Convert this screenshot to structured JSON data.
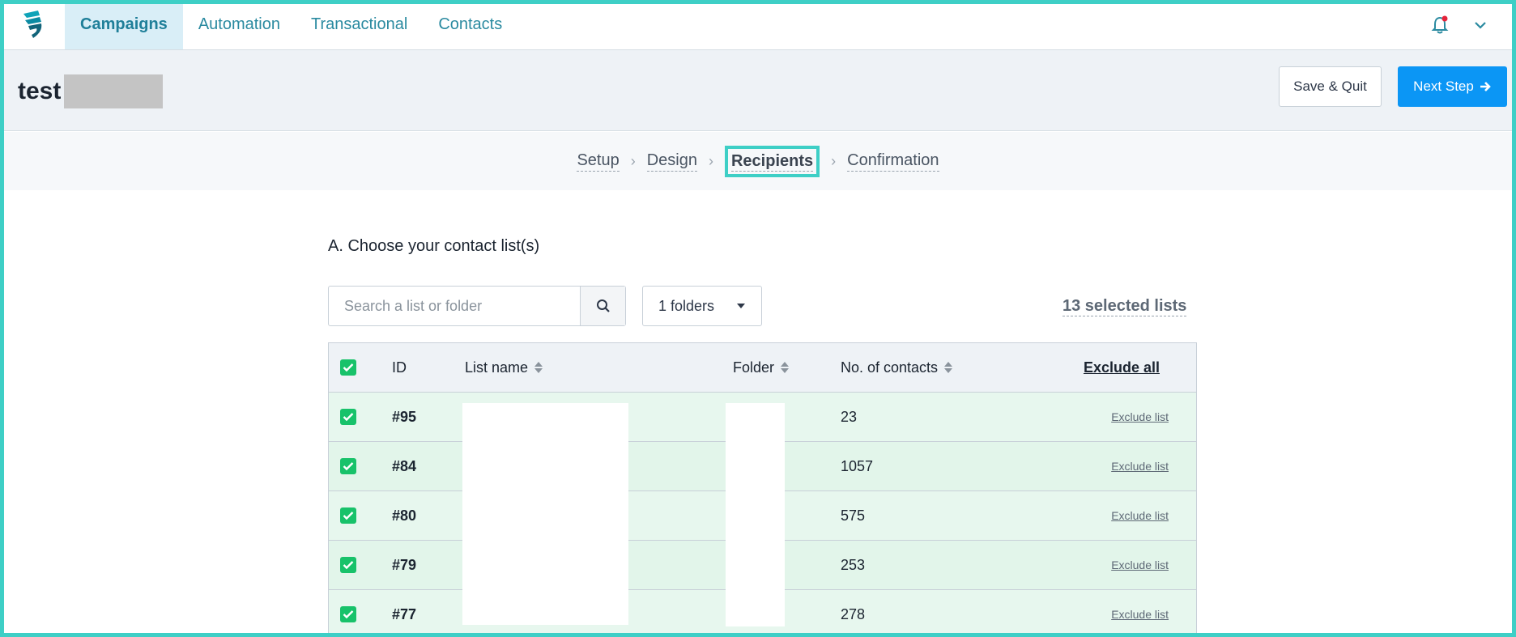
{
  "nav": {
    "tabs": [
      {
        "label": "Campaigns",
        "active": true
      },
      {
        "label": "Automation",
        "active": false
      },
      {
        "label": "Transactional",
        "active": false
      },
      {
        "label": "Contacts",
        "active": false
      }
    ],
    "notification_dot_color": "#e5243b",
    "accent_color": "#2a8aa0"
  },
  "header": {
    "title": "test",
    "save_quit_label": "Save & Quit",
    "next_step_label": "Next Step"
  },
  "steps": {
    "items": [
      "Setup",
      "Design",
      "Recipients",
      "Confirmation"
    ],
    "current": "Recipients"
  },
  "section": {
    "title": "A. Choose your contact list(s)",
    "search_placeholder": "Search a list or folder",
    "folder_select_value": "1 folders",
    "selected_count": "13 selected lists"
  },
  "table": {
    "headers": {
      "id": "ID",
      "list_name": "List name",
      "folder": "Folder",
      "contacts": "No. of contacts",
      "action": "Exclude all"
    },
    "rows": [
      {
        "id": "#95",
        "contacts": "23",
        "action": "Exclude list",
        "checked": true
      },
      {
        "id": "#84",
        "contacts": "1057",
        "action": "Exclude list",
        "checked": true
      },
      {
        "id": "#80",
        "contacts": "575",
        "action": "Exclude list",
        "checked": true
      },
      {
        "id": "#79",
        "contacts": "253",
        "action": "Exclude list",
        "checked": true
      },
      {
        "id": "#77",
        "contacts": "278",
        "action": "Exclude list",
        "checked": true
      }
    ]
  }
}
